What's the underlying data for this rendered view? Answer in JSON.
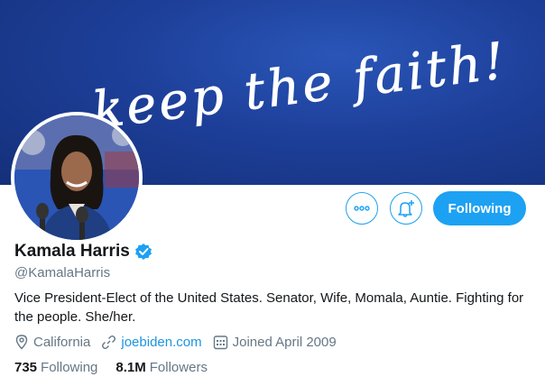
{
  "banner": {
    "text": "keep the faith!"
  },
  "profile": {
    "name": "Kamala Harris",
    "handle": "@KamalaHarris",
    "bio": "Vice President-Elect of the United States. Senator, Wife, Momala, Auntie. Fighting for the people. She/her.",
    "location": "California",
    "website": "joebiden.com",
    "joined": "Joined April 2009",
    "following_count": "735",
    "following_label": "Following",
    "followers_count": "8.1M",
    "followers_label": "Followers"
  },
  "actions": {
    "follow_label": "Following"
  },
  "icons": {
    "more": "more-icon",
    "notify": "notification-bell-icon",
    "verified": "verified-badge-icon",
    "location": "location-pin-icon",
    "link": "link-icon",
    "calendar": "calendar-icon"
  },
  "colors": {
    "accent": "#1da1f2",
    "banner": "#1d3f99",
    "muted": "#657786",
    "link": "#1b95e0"
  }
}
